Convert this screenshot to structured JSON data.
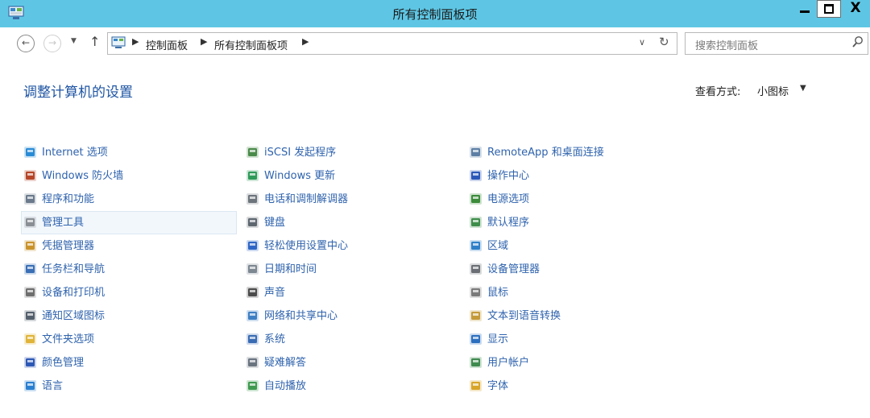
{
  "window": {
    "title": "所有控制面板项",
    "min_glyph": "",
    "max_glyph": "",
    "close_glyph": "X"
  },
  "nav": {
    "back_glyph": "←",
    "forward_glyph": "→",
    "dropdown_glyph": "▼",
    "up_glyph": "↑"
  },
  "address": {
    "sep_glyph": "▶",
    "crumbs": [
      "控制面板",
      "所有控制面板项"
    ],
    "dropdown_glyph": "∨",
    "refresh_glyph": "↻"
  },
  "search": {
    "placeholder": "搜索控制面板"
  },
  "main": {
    "title": "调整计算机的设置",
    "view_label": "查看方式:",
    "view_value": "小图标",
    "view_caret": "▼"
  },
  "columns": [
    [
      {
        "label": "Internet 选项",
        "icon": "internet-options-icon",
        "color": "#2a8bd5"
      },
      {
        "label": "Windows 防火墙",
        "icon": "firewall-icon",
        "color": "#b5462a"
      },
      {
        "label": "程序和功能",
        "icon": "programs-icon",
        "color": "#6b7a8c"
      },
      {
        "label": "管理工具",
        "icon": "admin-tools-icon",
        "color": "#8a8f96"
      },
      {
        "label": "凭据管理器",
        "icon": "credential-icon",
        "color": "#c9932c"
      },
      {
        "label": "任务栏和导航",
        "icon": "taskbar-icon",
        "color": "#3b6fb5"
      },
      {
        "label": "设备和打印机",
        "icon": "printer-icon",
        "color": "#6e6e6e"
      },
      {
        "label": "通知区域图标",
        "icon": "notification-icon",
        "color": "#55606d"
      },
      {
        "label": "文件夹选项",
        "icon": "folder-options-icon",
        "color": "#e0b43a"
      },
      {
        "label": "颜色管理",
        "icon": "color-mgmt-icon",
        "color": "#2e58b5"
      },
      {
        "label": "语言",
        "icon": "language-icon",
        "color": "#2b7fcf"
      }
    ],
    [
      {
        "label": "iSCSI 发起程序",
        "icon": "iscsi-icon",
        "color": "#4a8a4a"
      },
      {
        "label": "Windows 更新",
        "icon": "windows-update-icon",
        "color": "#2f9a5a"
      },
      {
        "label": "电话和调制解调器",
        "icon": "phone-modem-icon",
        "color": "#6d747c"
      },
      {
        "label": "键盘",
        "icon": "keyboard-icon",
        "color": "#5e6670"
      },
      {
        "label": "轻松使用设置中心",
        "icon": "ease-of-access-icon",
        "color": "#2f66c6"
      },
      {
        "label": "日期和时间",
        "icon": "datetime-icon",
        "color": "#7d8792"
      },
      {
        "label": "声音",
        "icon": "sound-icon",
        "color": "#4c4c4c"
      },
      {
        "label": "网络和共享中心",
        "icon": "network-icon",
        "color": "#3f7fc3"
      },
      {
        "label": "系统",
        "icon": "system-icon",
        "color": "#3a6cb3"
      },
      {
        "label": "疑难解答",
        "icon": "troubleshoot-icon",
        "color": "#6a7480"
      },
      {
        "label": "自动播放",
        "icon": "autoplay-icon",
        "color": "#3f9a4f"
      }
    ],
    [
      {
        "label": "RemoteApp 和桌面连接",
        "icon": "remoteapp-icon",
        "color": "#5d7fa5"
      },
      {
        "label": "操作中心",
        "icon": "action-center-icon",
        "color": "#2b57b8"
      },
      {
        "label": "电源选项",
        "icon": "power-icon",
        "color": "#3b8b3b"
      },
      {
        "label": "默认程序",
        "icon": "default-programs-icon",
        "color": "#3e8d4a"
      },
      {
        "label": "区域",
        "icon": "region-icon",
        "color": "#2f80c8"
      },
      {
        "label": "设备管理器",
        "icon": "device-manager-icon",
        "color": "#6b6f75"
      },
      {
        "label": "鼠标",
        "icon": "mouse-icon",
        "color": "#7a7a7a"
      },
      {
        "label": "文本到语音转换",
        "icon": "text-to-speech-icon",
        "color": "#c49a3a"
      },
      {
        "label": "显示",
        "icon": "display-icon",
        "color": "#2d6fbf"
      },
      {
        "label": "用户帐户",
        "icon": "user-accounts-icon",
        "color": "#3f8a4f"
      },
      {
        "label": "字体",
        "icon": "fonts-icon",
        "color": "#d8a52a"
      }
    ]
  ],
  "hover_item": {
    "column": 0,
    "index": 3
  },
  "colors": {
    "titlebar": "#5ec6e4",
    "link": "#2f63ad",
    "heading": "#1f55a3",
    "hover_bg": "#f2f7fc"
  }
}
